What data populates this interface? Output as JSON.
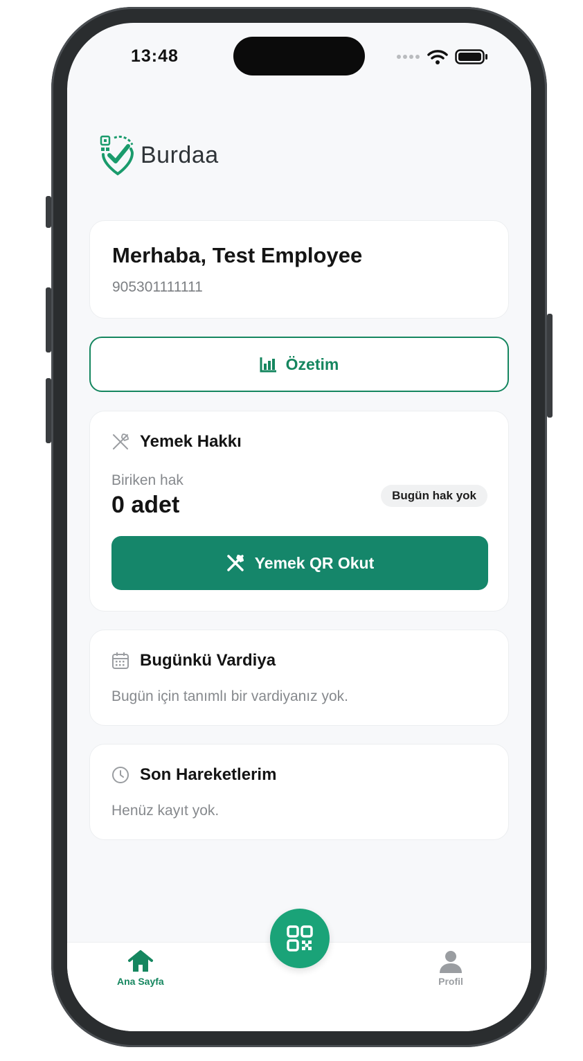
{
  "status_bar": {
    "time": "13:48"
  },
  "brand": {
    "name": "Burdaa",
    "accent": "#15865f"
  },
  "greeting": {
    "title": "Merhaba, Test Employee",
    "phone": "905301111111"
  },
  "summary_button": {
    "label": "Özetim",
    "icon": "bar-chart-icon"
  },
  "meal_card": {
    "title": "Yemek Hakkı",
    "icon": "utensils-icon",
    "accrued_label": "Biriken hak",
    "accrued_value": "0 adet",
    "badge": "Bugün hak yok",
    "scan_button": "Yemek QR Okut"
  },
  "shift_card": {
    "title": "Bugünkü Vardiya",
    "icon": "calendar-icon",
    "message": "Bugün için tanımlı bir vardiyanız yok."
  },
  "activity_card": {
    "title": "Son Hareketlerim",
    "icon": "clock-icon",
    "message": "Henüz kayıt yok."
  },
  "tab_bar": {
    "home_label": "Ana Sayfa",
    "profile_label": "Profil",
    "active_color": "#15865f",
    "inactive_color": "#9a9da1",
    "fab_icon": "qr-code-icon"
  }
}
